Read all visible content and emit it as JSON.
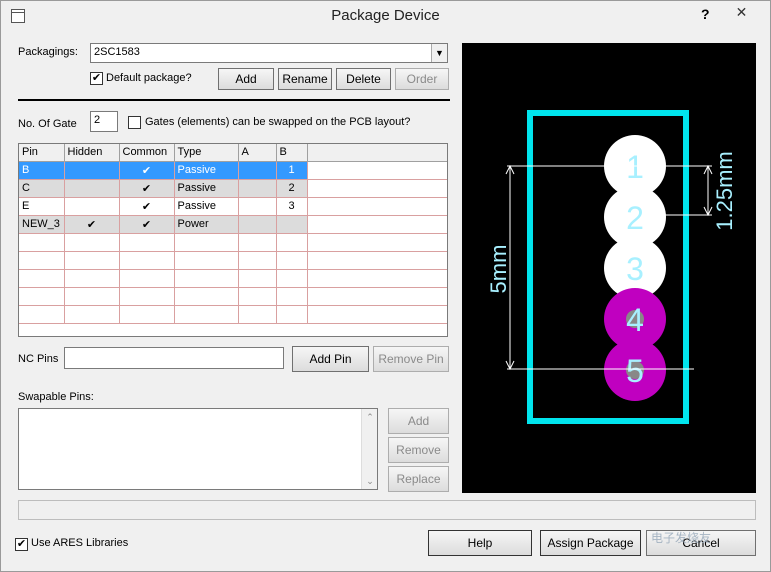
{
  "window": {
    "title": "Package Device",
    "help_glyph": "?",
    "close_glyph": "✕"
  },
  "packagings": {
    "label": "Packagings:",
    "value": "2SC1583",
    "default_label": "Default package?",
    "default_checked": true
  },
  "buttons": {
    "add": "Add",
    "rename": "Rename",
    "delete": "Delete",
    "order": "Order",
    "add_pin": "Add Pin",
    "remove_pin": "Remove Pin",
    "swap_add": "Add",
    "swap_remove": "Remove",
    "swap_replace": "Replace",
    "help": "Help",
    "assign": "Assign Package",
    "cancel": "Cancel"
  },
  "gates": {
    "label": "No. Of Gate",
    "value": "2",
    "swap_label": "Gates (elements) can be swapped on the PCB layout?"
  },
  "pin_table": {
    "headers": [
      "Pin",
      "Hidden",
      "Common",
      "Type",
      "A",
      "B"
    ],
    "rows": [
      {
        "pin": "B",
        "hidden": "",
        "common": "✔",
        "type": "Passive",
        "a": "",
        "b": "1"
      },
      {
        "pin": "C",
        "hidden": "",
        "common": "✔",
        "type": "Passive",
        "a": "",
        "b": "2"
      },
      {
        "pin": "E",
        "hidden": "",
        "common": "✔",
        "type": "Passive",
        "a": "",
        "b": "3"
      },
      {
        "pin": "NEW_3",
        "hidden": "✔",
        "common": "✔",
        "type": "Power",
        "a": "",
        "b": ""
      }
    ]
  },
  "nc_pins": {
    "label": "NC Pins",
    "value": ""
  },
  "swapable": {
    "label": "Swapable Pins:"
  },
  "ares": {
    "label": "Use ARES Libraries",
    "checked": true
  },
  "preview": {
    "pads": [
      "1",
      "2",
      "3",
      "4",
      "5"
    ],
    "dim_pitch": "1.25mm",
    "dim_span": "5mm",
    "colors": {
      "outline": "#00e5ee",
      "pad_white": "#ffffff",
      "pad_magenta": "#c000c0",
      "text": "#a8f0ff"
    }
  },
  "watermark": "电子发烧友"
}
